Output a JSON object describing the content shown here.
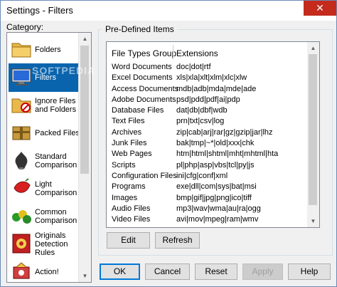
{
  "window": {
    "title": "Settings - Filters",
    "close_glyph": "✕"
  },
  "category": {
    "label": "Category:",
    "items": [
      {
        "label": "Folders",
        "icon": "folder-icon"
      },
      {
        "label": "Filters",
        "icon": "filter-monitor-icon",
        "selected": true
      },
      {
        "label": "Ignore Files and Folders",
        "icon": "ignore-folder-icon"
      },
      {
        "label": "Packed Files",
        "icon": "packed-files-icon"
      },
      {
        "label": "Standard Comparison",
        "icon": "standard-comparison-icon"
      },
      {
        "label": "Light Comparison",
        "icon": "light-comparison-icon"
      },
      {
        "label": "Common Comparison",
        "icon": "common-comparison-icon"
      },
      {
        "label": "Originals Detection Rules",
        "icon": "originals-detection-icon"
      },
      {
        "label": "Action!",
        "icon": "action-icon"
      }
    ]
  },
  "predefined": {
    "label": "Pre-Defined Items",
    "headers": {
      "group": "File Types Group",
      "ext": "Extensions"
    },
    "rows": [
      {
        "group": "Word Documents",
        "ext": "doc|dot|rtf"
      },
      {
        "group": "Excel Documents",
        "ext": "xls|xla|xlt|xlm|xlc|xlw"
      },
      {
        "group": "Access Documents",
        "ext": "mdb|adb|mda|mde|ade"
      },
      {
        "group": "Adobe Documents",
        "ext": "psd|pdd|pdf|ai|pdp"
      },
      {
        "group": "Database Files",
        "ext": "dat|db|dbf|wdb"
      },
      {
        "group": "Text Files",
        "ext": "prn|txt|csv|log"
      },
      {
        "group": "Archives",
        "ext": "zip|cab|arj|rar|gz|gzip|jar|lhz"
      },
      {
        "group": "Junk Files",
        "ext": "bak|tmp|~*|old|xxx|chk"
      },
      {
        "group": "Web Pages",
        "ext": "htm|html|shtml|mht|mhtml|hta"
      },
      {
        "group": "Scripts",
        "ext": "pl|php|asp|vbs|tcl|py|js"
      },
      {
        "group": "Configuration Files",
        "ext": "ini|cfg|conf|xml"
      },
      {
        "group": "Programs",
        "ext": "exe|dll|com|sys|bat|msi"
      },
      {
        "group": "Images",
        "ext": "bmp|gif|jpg|png|ico|tiff"
      },
      {
        "group": "Audio Files",
        "ext": "mp3|wav|wma|au|ra|ogg"
      },
      {
        "group": "Video Files",
        "ext": "avi|mov|mpeg|ram|wmv"
      }
    ],
    "edit_label": "Edit",
    "refresh_label": "Refresh"
  },
  "footer": {
    "ok": "OK",
    "cancel": "Cancel",
    "reset": "Reset",
    "apply": "Apply",
    "help": "Help"
  },
  "watermark": "SOFTPEDIA",
  "colors": {
    "selection": "#0a64ad",
    "close": "#c42b1c"
  }
}
